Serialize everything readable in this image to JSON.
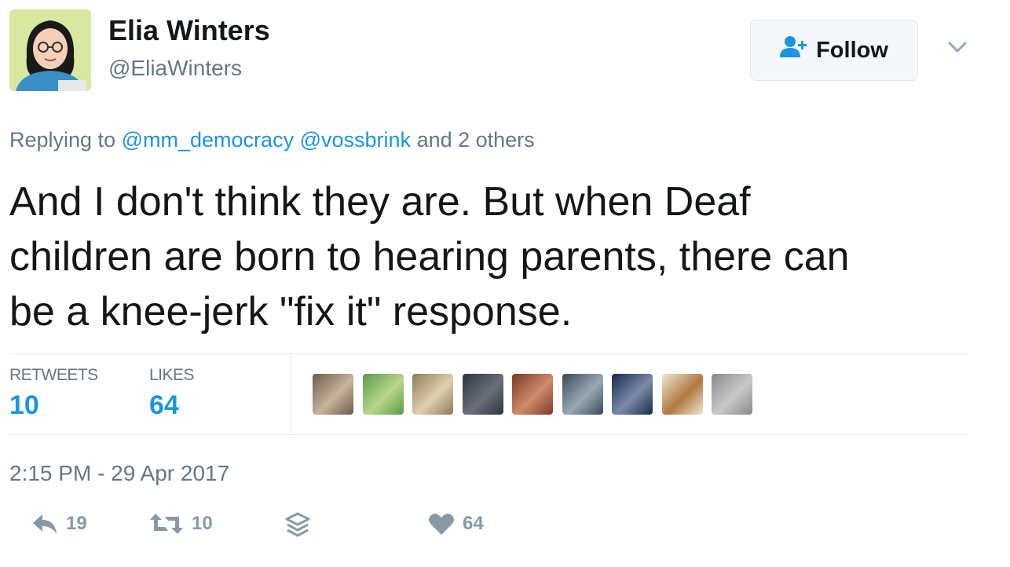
{
  "author": {
    "display_name": "Elia Winters",
    "handle": "@EliaWinters"
  },
  "follow_button": {
    "label": "Follow"
  },
  "reply_context": {
    "prefix": "Replying to",
    "mentions": [
      "@mm_democracy",
      "@vossbrink"
    ],
    "suffix": "and 2 others"
  },
  "tweet": {
    "lines": [
      "And I don't think they are. But when Deaf",
      "children are born to hearing parents, there can",
      "be a knee-jerk \"fix it\" response."
    ]
  },
  "stats": {
    "retweets_label": "RETWEETS",
    "retweets_value": "10",
    "likes_label": "LIKES",
    "likes_value": "64"
  },
  "likers": [
    {
      "name": "liker-avatar-1",
      "colors": [
        "#6b5b4f",
        "#c9b39a"
      ]
    },
    {
      "name": "liker-avatar-2",
      "colors": [
        "#5a9a4a",
        "#b8d68a"
      ]
    },
    {
      "name": "liker-avatar-3",
      "colors": [
        "#8a7a5a",
        "#e0d0b0"
      ]
    },
    {
      "name": "liker-avatar-4",
      "colors": [
        "#2e3440",
        "#6b6f78"
      ]
    },
    {
      "name": "liker-avatar-5",
      "colors": [
        "#7a3a2a",
        "#d08a6a"
      ]
    },
    {
      "name": "liker-avatar-6",
      "colors": [
        "#3a4a5a",
        "#9aa8b4"
      ]
    },
    {
      "name": "liker-avatar-7",
      "colors": [
        "#1a2a4a",
        "#7a8aa8"
      ]
    },
    {
      "name": "liker-avatar-8",
      "colors": [
        "#f0e8d8",
        "#b07840"
      ]
    },
    {
      "name": "liker-avatar-9",
      "colors": [
        "#8a8a8a",
        "#c8c8c8"
      ]
    }
  ],
  "timestamp": "2:15 PM - 29 Apr 2017",
  "actions": {
    "reply_count": "19",
    "retweet_count": "10",
    "like_count": "64"
  },
  "colors": {
    "link_blue": "#1b95e0",
    "muted_gray": "#657786",
    "icon_gray": "#8899a6"
  }
}
